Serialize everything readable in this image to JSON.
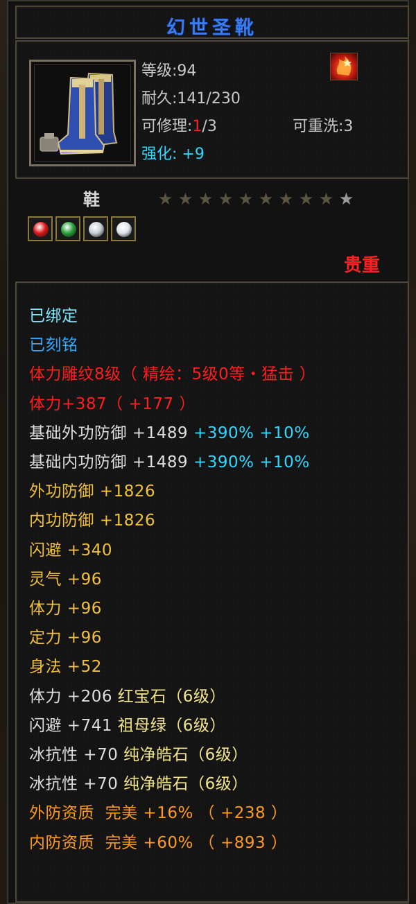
{
  "item": {
    "name": "幻世圣靴",
    "level_label": "等级:",
    "level_value": "94",
    "durability_label": "耐久:",
    "durability_value": "141/230",
    "repair_label": "可修理:",
    "repair_used": "1",
    "repair_total": "/3",
    "rewash_label": "可重洗:",
    "rewash_value": "3",
    "enhance_label": "强化:",
    "enhance_value": "+9",
    "slot": "鞋",
    "stars_filled": 9,
    "stars_total": 10,
    "precious": "贵重"
  },
  "gems": [
    {
      "name": "red-gem",
      "color": "#e01818"
    },
    {
      "name": "green-gem",
      "color": "#2aa23a"
    },
    {
      "name": "white-gem",
      "color": "#c8d0d8"
    },
    {
      "name": "white-gem",
      "color": "#dfe6ee"
    }
  ],
  "properties": [
    {
      "segments": [
        {
          "text": "已绑定",
          "color": "c-cyan"
        }
      ]
    },
    {
      "segments": [
        {
          "text": "已刻铭",
          "color": "c-blue"
        }
      ]
    },
    {
      "segments": [
        {
          "text": "体力雕纹8级（ 精绘：5级0等・猛击 ）",
          "color": "c-red"
        }
      ]
    },
    {
      "segments": [
        {
          "text": "体力+387（ +177 ）",
          "color": "c-red"
        }
      ]
    },
    {
      "segments": [
        {
          "text": "基础外功防御 +1489 ",
          "color": "c-white"
        },
        {
          "text": "+390% +10%",
          "color": "c-teal"
        }
      ]
    },
    {
      "segments": [
        {
          "text": "基础内功防御 +1489 ",
          "color": "c-white"
        },
        {
          "text": "+390% +10%",
          "color": "c-teal"
        }
      ]
    },
    {
      "segments": [
        {
          "text": "外功防御 +1826",
          "color": "c-yellow"
        }
      ]
    },
    {
      "segments": [
        {
          "text": "内功防御 +1826",
          "color": "c-yellow"
        }
      ]
    },
    {
      "segments": [
        {
          "text": "闪避 +340",
          "color": "c-yellow"
        }
      ]
    },
    {
      "segments": [
        {
          "text": "灵气 +96",
          "color": "c-yellow"
        }
      ]
    },
    {
      "segments": [
        {
          "text": "体力 +96",
          "color": "c-yellow"
        }
      ]
    },
    {
      "segments": [
        {
          "text": "定力 +96",
          "color": "c-yellow"
        }
      ]
    },
    {
      "segments": [
        {
          "text": "身法 +52",
          "color": "c-yellow"
        }
      ]
    },
    {
      "segments": [
        {
          "text": "体力 +206 ",
          "color": "c-white"
        },
        {
          "text": "红宝石（6级）",
          "color": "c-lightyellow"
        }
      ]
    },
    {
      "segments": [
        {
          "text": "闪避 +741 ",
          "color": "c-white"
        },
        {
          "text": "祖母绿（6级）",
          "color": "c-lightyellow"
        }
      ]
    },
    {
      "segments": [
        {
          "text": "冰抗性 +70 ",
          "color": "c-white"
        },
        {
          "text": "纯净皓石（6级）",
          "color": "c-lightyellow"
        }
      ]
    },
    {
      "segments": [
        {
          "text": "冰抗性 +70 ",
          "color": "c-white"
        },
        {
          "text": "纯净皓石（6级）",
          "color": "c-lightyellow"
        }
      ]
    },
    {
      "segments": [
        {
          "text": "外防资质  完美 +16% （ +238 ）",
          "color": "c-orange"
        }
      ]
    },
    {
      "segments": [
        {
          "text": "内防资质  完美 +60% （ +893 ）",
          "color": "c-orange"
        }
      ]
    }
  ]
}
